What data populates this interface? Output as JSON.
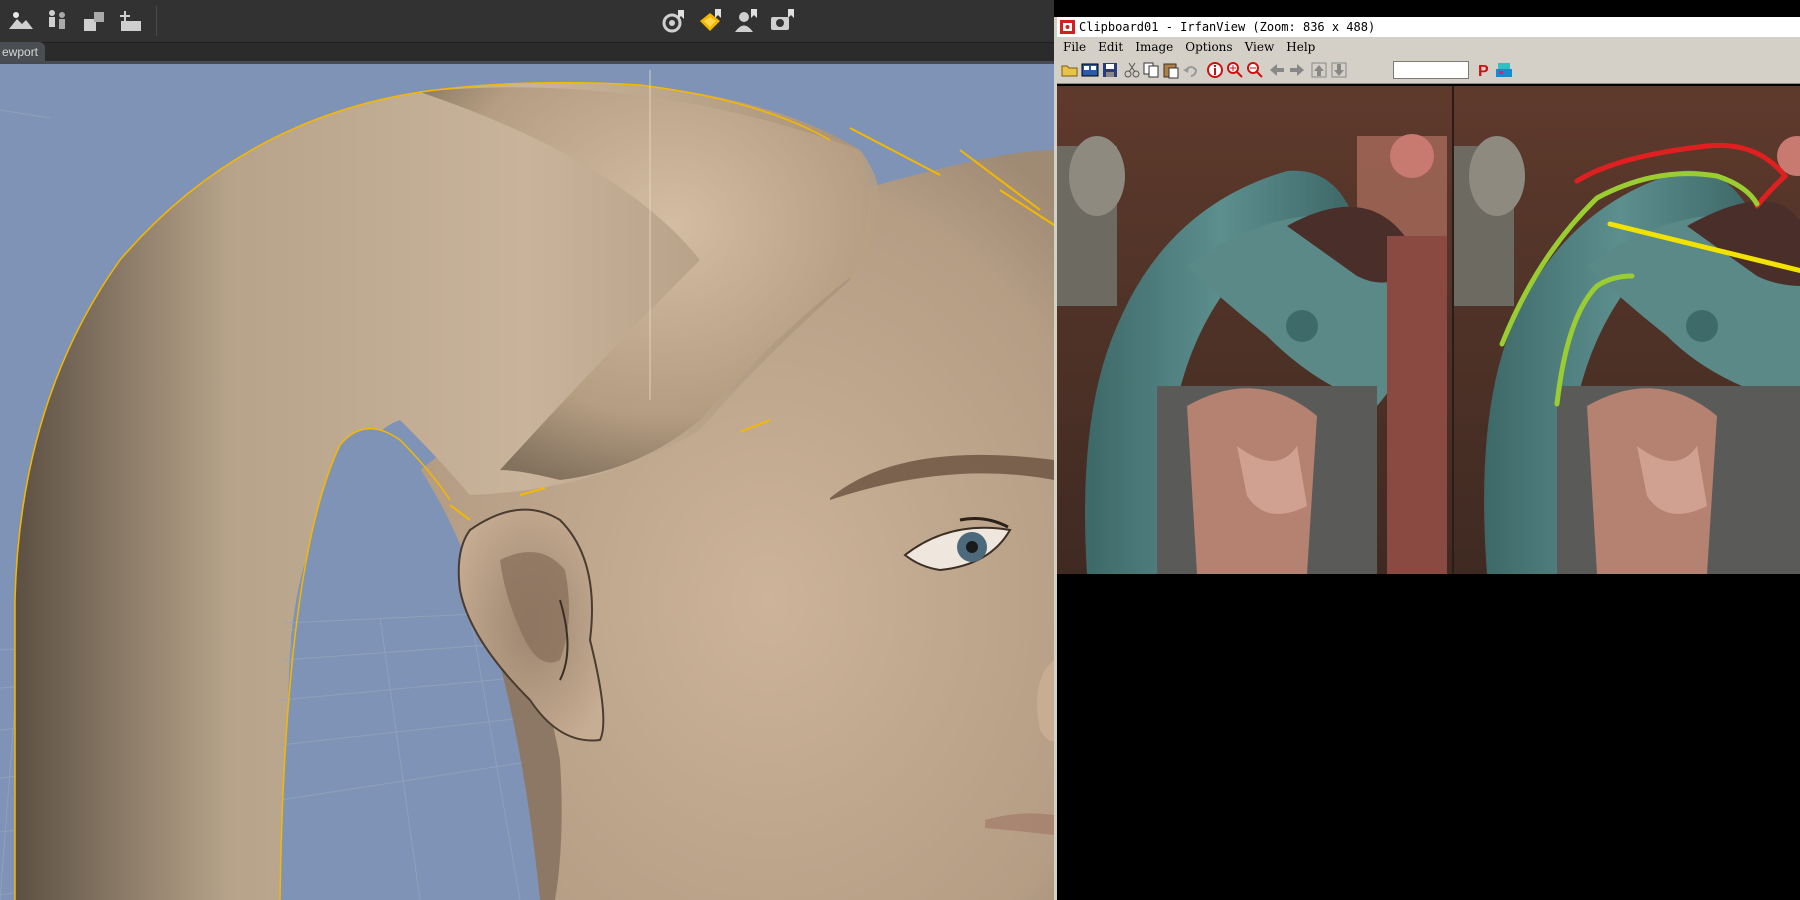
{
  "app": {
    "tab_label": "ewport",
    "toolbar_icons": [
      "scene-icon",
      "figures-icon",
      "add-props-icon",
      "add-scene-icon",
      "render-settings-icon",
      "render-icon",
      "camera-figure-icon",
      "snapshot-camera-icon"
    ]
  },
  "irfanview": {
    "title": "Clipboard01 - IrfanView (Zoom: 836 x 488)",
    "menu": [
      "File",
      "Edit",
      "Image",
      "Options",
      "View",
      "Help"
    ],
    "page_input_value": "",
    "toolbar_icons": [
      "open-icon",
      "thumbnails-icon",
      "save-icon",
      "cut-icon",
      "copy-icon",
      "paste-icon",
      "undo-icon",
      "info-icon",
      "zoom-in-icon",
      "zoom-out-icon",
      "previous-icon",
      "next-icon",
      "first-icon",
      "last-icon",
      "paint-icon",
      "scan-icon"
    ]
  },
  "colors": {
    "viewport_bg": "#7e93b5",
    "skin": "#b49e85",
    "selection_outline": "#f5b800",
    "red_mark": "#e02020",
    "green_mark": "#9acd32",
    "yellow_mark": "#f2e200"
  }
}
